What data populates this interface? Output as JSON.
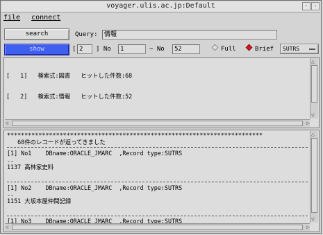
{
  "window": {
    "title": "voyager.ulis.ac.jp:Default"
  },
  "menu": [
    {
      "label": "file"
    },
    {
      "label": "connect"
    }
  ],
  "toolbar": {
    "search_label": "search",
    "query_label": "Query:",
    "query_value": "情報",
    "show_label": "show",
    "set_prefix": "[",
    "set_value": "2",
    "set_suffix": "] No",
    "from_value": "1",
    "to_label": "~ No",
    "to_value": "52",
    "full_label": "Full",
    "brief_label": "Brief",
    "format_value": "SUTRS"
  },
  "history": [
    "[   1]   検索式:図書   ヒットした件数:68",
    "[   2]   検索式:情報   ヒットした件数:52"
  ],
  "results": {
    "stars": "*************************************************************************",
    "message": "   68件のレコードが返ってきました",
    "records": [
      {
        "header": "[1] No1    DBname:ORACLE_JMARC  ,Record type:SUTRS",
        "sep": "--",
        "body": "1137 高林家史料"
      },
      {
        "header": "[1] No2    DBname:ORACLE_JMARC  ,Record type:SUTRS",
        "sep": "--",
        "body": "1151 大坂本屋仲間記録"
      },
      {
        "header": "[1] No3    DBname:ORACLE_JMARC  ,Record type:SUTRS"
      }
    ]
  },
  "colors": {
    "show_button": "#3f5ff0",
    "radio_on": "#cc1e1e",
    "window_bg": "#d4d4d4"
  }
}
